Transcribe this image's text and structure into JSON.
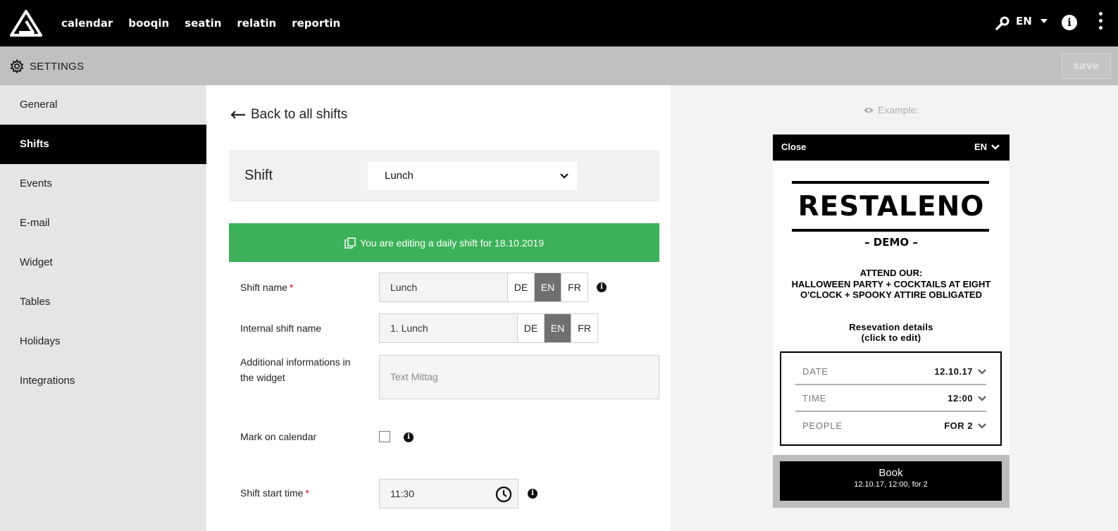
{
  "topnav": {
    "links": [
      "calendar",
      "booqin",
      "seatin",
      "relatin",
      "reportin"
    ],
    "language": "EN"
  },
  "settings_bar": {
    "title": "SETTINGS",
    "save_label": "save"
  },
  "sidebar": {
    "items": [
      {
        "label": "General"
      },
      {
        "label": "Shifts",
        "active": true
      },
      {
        "label": "Events"
      },
      {
        "label": "E-mail"
      },
      {
        "label": "Widget"
      },
      {
        "label": "Tables"
      },
      {
        "label": "Holidays"
      },
      {
        "label": "Integrations"
      }
    ]
  },
  "main": {
    "back_label": "Back to all shifts",
    "shift_label": "Shift",
    "shift_selected": "Lunch",
    "banner_text": "You are editing a daily shift for 18.10.2019",
    "fields": {
      "shift_name": {
        "label": "Shift name",
        "required": "*",
        "value": "Lunch",
        "languages": [
          "DE",
          "EN",
          "FR"
        ],
        "active_language": "EN"
      },
      "internal_shift_name": {
        "label": "Internal shift name",
        "value": "1. Lunch",
        "languages": [
          "DE",
          "EN",
          "FR"
        ],
        "active_language": "EN"
      },
      "additional_info": {
        "label_line1": "Additional informations in",
        "label_line2": "the widget",
        "placeholder": "Text Mittag"
      },
      "mark_on_calendar": {
        "label": "Mark on calendar",
        "checked": false
      },
      "shift_start_time": {
        "label": "Shift start time",
        "required": "*",
        "value": "11:30"
      }
    },
    "colors": {
      "banner": "#3cb15a",
      "required": "#d0021b",
      "active_lang": "#707070"
    }
  },
  "preview": {
    "example_label": "Example:",
    "widget": {
      "close_label": "Close",
      "language": "EN",
      "brand_name": "RESTALENO",
      "brand_sub": "– DEMO –",
      "attend_lines": [
        "ATTEND OUR:",
        "HALLOWEEN PARTY + COCKTAILS AT EIGHT",
        "O'CLOCK + SPOOKY ATTIRE OBLIGATED"
      ],
      "details_title": "Resevation details",
      "details_hint": "(click to edit)",
      "rows": [
        {
          "key": "DATE",
          "value": "12.10.17"
        },
        {
          "key": "TIME",
          "value": "12:00"
        },
        {
          "key": "PEOPLE",
          "value": "FOR 2"
        }
      ],
      "book_label": "Book",
      "book_detail": "12.10.17, 12:00, for 2"
    }
  }
}
